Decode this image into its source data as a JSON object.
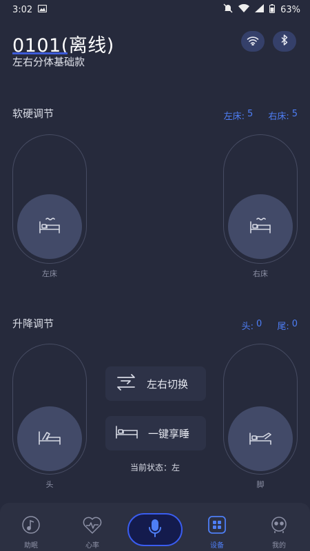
{
  "status_bar": {
    "time": "3:02",
    "battery": "63%"
  },
  "device": {
    "title": "0101(离线)",
    "subtitle": "左右分体基础款"
  },
  "firmness": {
    "title": "软硬调节",
    "left_label": "左床:",
    "left_value": "5",
    "right_label": "右床:",
    "right_value": "5",
    "left_slider_label": "左床",
    "right_slider_label": "右床"
  },
  "lift": {
    "title": "升降调节",
    "head_label": "头:",
    "head_value": "0",
    "foot_label": "尾:",
    "foot_value": "0",
    "head_slider_label": "头",
    "foot_slider_label": "脚"
  },
  "actions": {
    "switch_label": "左右切换",
    "sleep_label": "一键享睡",
    "current_state": "当前状态：左"
  },
  "nav": {
    "items": [
      {
        "label": "助眠",
        "icon": "music-note-icon"
      },
      {
        "label": "心率",
        "icon": "heart-rate-icon"
      },
      {
        "label": "设备",
        "icon": "device-grid-icon",
        "active": true
      },
      {
        "label": "我的",
        "icon": "robot-face-icon"
      }
    ],
    "mic_icon": "microphone-icon"
  },
  "colors": {
    "background": "#262a3c",
    "accent": "#4e7ef5",
    "knob": "#424a68"
  }
}
